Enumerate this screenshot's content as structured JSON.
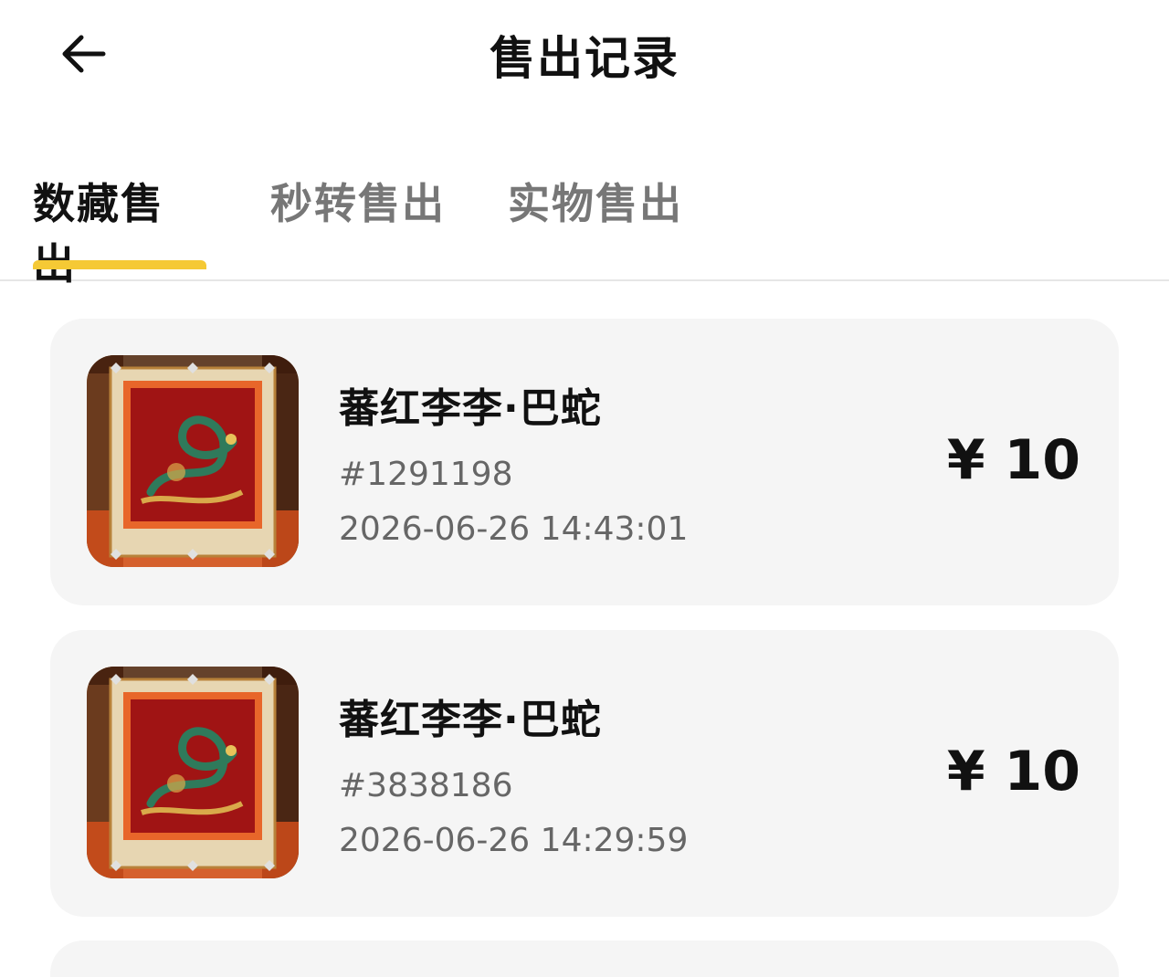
{
  "header": {
    "title": "售出记录",
    "back_icon": "arrow-left-icon"
  },
  "tabs": [
    {
      "label": "数藏售出",
      "active": true
    },
    {
      "label": "秒转售出",
      "active": false
    },
    {
      "label": "实物售出",
      "active": false
    }
  ],
  "colors": {
    "accent": "#f5c935",
    "card_bg": "#f5f5f5",
    "muted_text": "#666666"
  },
  "records": [
    {
      "name": "蕃红李李·巴蛇",
      "serial": "#1291198",
      "time": "2026-06-26 14:43:01",
      "price": "¥ 10",
      "thumbnail_icon": "dragon-artwork-image"
    },
    {
      "name": "蕃红李李·巴蛇",
      "serial": "#3838186",
      "time": "2026-06-26 14:29:59",
      "price": "¥ 10",
      "thumbnail_icon": "dragon-artwork-image"
    }
  ]
}
